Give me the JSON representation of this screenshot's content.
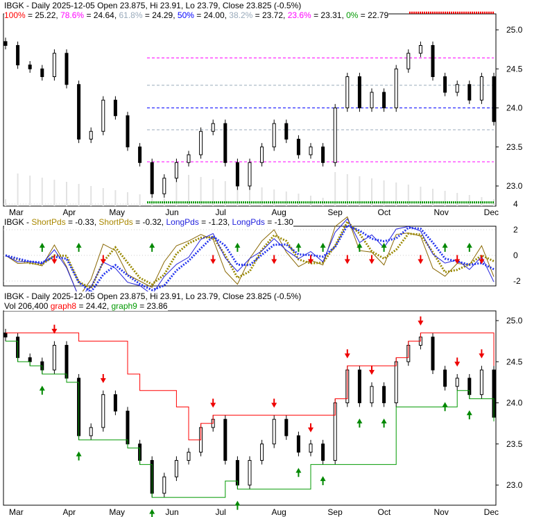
{
  "chart_data": {
    "type": "candlestick",
    "ticker": "IBGK",
    "title": "IBGK - Daily 2025-12-05 Open 23.875, Hi 23.91, Lo 23.79, Close 23.825 (-0.5%)",
    "fib": [
      {
        "label": "100%",
        "value": 25.22,
        "color": "#ff0000"
      },
      {
        "label": "78.6%",
        "value": 24.64,
        "color": "#ff00ff"
      },
      {
        "label": "61.8%",
        "value": 24.29,
        "color": "#99aabb"
      },
      {
        "label": "50%",
        "value": 24.0,
        "color": "#0000ff"
      },
      {
        "label": "38.2%",
        "value": 23.72,
        "color": "#99aabb"
      },
      {
        "label": "23.6%",
        "value": 23.31,
        "color": "#ff00ff"
      },
      {
        "label": "0%",
        "value": 22.79,
        "color": "#009900"
      }
    ],
    "fib_text": {
      "f0": "100%",
      "v0": " = 25.22, ",
      "f1": "78.6%",
      "v1": " = 24.64, ",
      "f2": "61.8%",
      "v2": " = 24.29, ",
      "f3": "50%",
      "v3": " = 24.00, ",
      "f4": "38.2%",
      "v4": " = 23.72, ",
      "f5": "23.6%",
      "v5": " = 23.31, ",
      "f6": "0%",
      "v6": " = 22.79"
    },
    "osc_text": {
      "name": "IBGK - ",
      "s1": "ShortPds",
      "v1": " = -0.33, ",
      "s2": "ShortPds",
      "v2": " = -0.32, ",
      "l1": "LongPds",
      "v3": " = -1.23, ",
      "l2": "LongPds",
      "v4": " = -1.30"
    },
    "lower_text": {
      "vol": "Vol 206,400 ",
      "g8": "graph8",
      "v8": " = 24.42, ",
      "g9": "graph9",
      "v9": " = 23.86"
    },
    "months": [
      {
        "label": "Mar",
        "i": 0.4
      },
      {
        "label": "Apr",
        "i": 4.8
      },
      {
        "label": "May",
        "i": 8.6
      },
      {
        "label": "Jun",
        "i": 13.2
      },
      {
        "label": "Jul",
        "i": 17.3
      },
      {
        "label": "Aug",
        "i": 21.9
      },
      {
        "label": "Sep",
        "i": 26.5
      },
      {
        "label": "Oct",
        "i": 30.6
      },
      {
        "label": "Nov",
        "i": 35.2
      },
      {
        "label": "Dec",
        "i": 39.3
      }
    ],
    "price_ticks": [
      25.0,
      24.5,
      24.0,
      23.5,
      23.0
    ],
    "osc_ticks": [
      4,
      2,
      0,
      -2
    ],
    "closes": [
      24.8,
      24.55,
      24.5,
      24.4,
      24.7,
      24.3,
      23.6,
      23.7,
      24.1,
      23.9,
      23.5,
      23.3,
      22.9,
      23.1,
      23.3,
      23.4,
      23.7,
      23.8,
      23.3,
      23.0,
      23.3,
      23.5,
      23.8,
      23.6,
      23.4,
      23.5,
      23.3,
      24.0,
      24.4,
      24.0,
      24.2,
      24.0,
      24.5,
      24.7,
      24.8,
      24.4,
      24.2,
      24.3,
      24.1,
      24.4,
      23.825
    ]
  }
}
